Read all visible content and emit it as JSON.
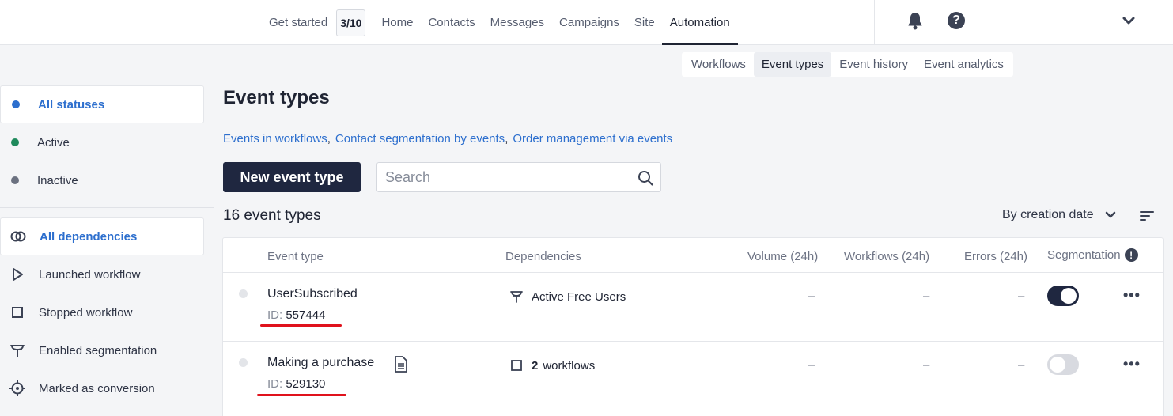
{
  "topnav": {
    "get_started": "Get started",
    "progress": "3/10",
    "items": [
      "Home",
      "Contacts",
      "Messages",
      "Campaigns",
      "Site",
      "Automation"
    ]
  },
  "subtabs": [
    "Workflows",
    "Event types",
    "Event history",
    "Event analytics"
  ],
  "sidebar": {
    "statuses": [
      {
        "label": "All statuses",
        "color": "#2d6fce"
      },
      {
        "label": "Active",
        "color": "#1f8a5c"
      },
      {
        "label": "Inactive",
        "color": "#6b7180"
      }
    ],
    "dependencies": [
      "All dependencies",
      "Launched workflow",
      "Stopped workflow",
      "Enabled segmentation",
      "Marked as conversion"
    ]
  },
  "main": {
    "title": "Event types",
    "links": [
      "Events in workflows",
      "Contact segmentation by events",
      "Order management via events"
    ],
    "new_button": "New event type",
    "search_placeholder": "Search",
    "count": "16 event types",
    "sort_label": "By creation date"
  },
  "table": {
    "headers": {
      "event_type": "Event type",
      "dependencies": "Dependencies",
      "volume": "Volume (24h)",
      "workflows": "Workflows (24h)",
      "errors": "Errors (24h)",
      "segmentation": "Segmentation"
    },
    "rows": [
      {
        "name": "UserSubscribed",
        "id_label": "ID:",
        "id": "557444",
        "dependency": "Active Free Users",
        "volume": "–",
        "workflows": "–",
        "errors": "–",
        "segmentation": true
      },
      {
        "name": "Making a purchase",
        "id_label": "ID:",
        "id": "529130",
        "dependency_count": "2",
        "dependency": "workflows",
        "volume": "–",
        "workflows": "–",
        "errors": "–",
        "segmentation": false
      }
    ]
  },
  "colors": {
    "accent": "#2d6fce",
    "dark": "#1f2740",
    "annotation": "#e0121c"
  }
}
